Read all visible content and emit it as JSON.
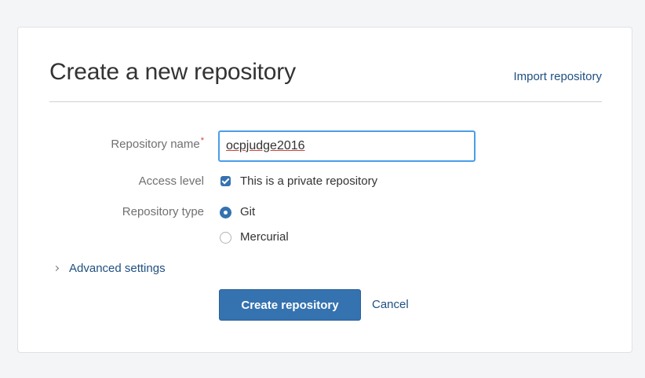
{
  "header": {
    "title": "Create a new repository",
    "import_link": "Import repository"
  },
  "form": {
    "repository_name": {
      "label": "Repository name",
      "required_marker": "*",
      "value": "ocpjudge2016"
    },
    "access_level": {
      "label": "Access level",
      "checkbox_label": "This is a private repository",
      "checked": true
    },
    "repository_type": {
      "label": "Repository type",
      "options": [
        {
          "label": "Git",
          "selected": true
        },
        {
          "label": "Mercurial",
          "selected": false
        }
      ]
    },
    "advanced_settings": "Advanced settings"
  },
  "actions": {
    "create_label": "Create repository",
    "cancel_label": "Cancel"
  },
  "colors": {
    "primary": "#3572b0",
    "link": "#205081",
    "required": "#d04437",
    "focus_border": "#4a9ee8"
  }
}
